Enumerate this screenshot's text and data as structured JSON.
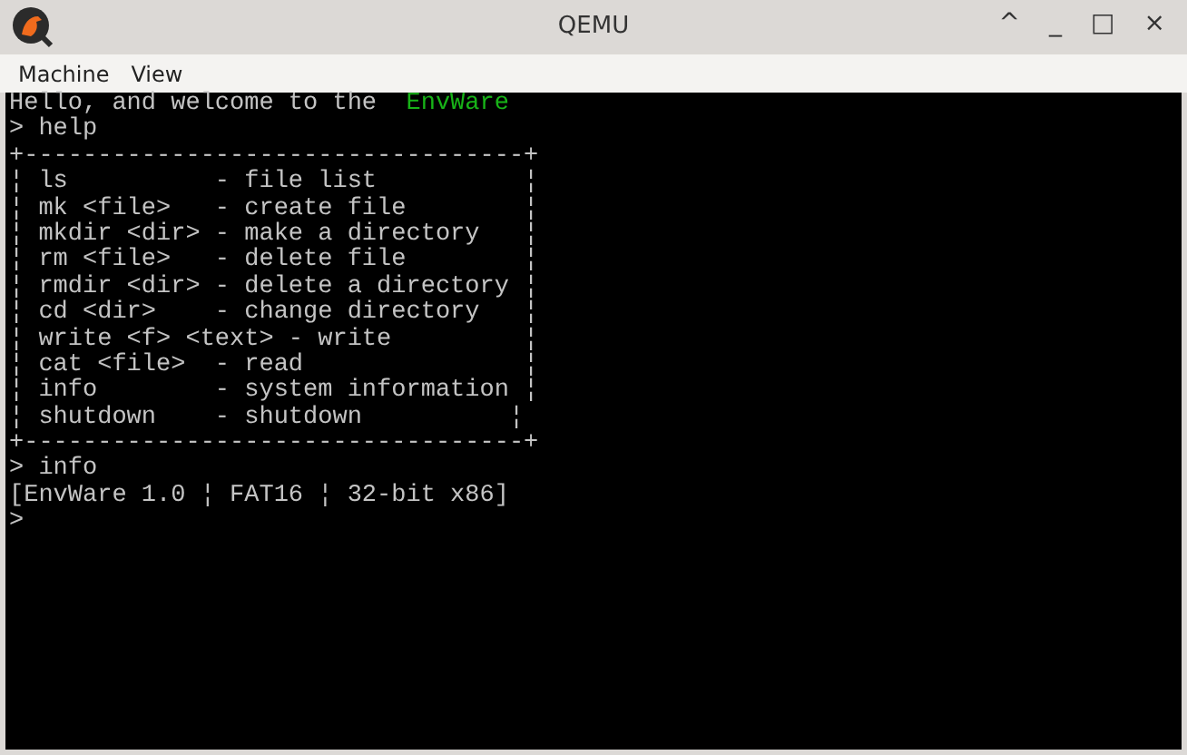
{
  "window": {
    "title": "QEMU",
    "controls": [
      "^",
      "_",
      "□",
      "×"
    ]
  },
  "menu": [
    {
      "label": "Machine"
    },
    {
      "label": "View"
    }
  ],
  "terminal": {
    "lines": [
      {
        "segments": [
          {
            "text": "Hello, and welcome to the  ",
            "kind": "normal"
          },
          {
            "text": "EnvWare",
            "kind": "highlight"
          }
        ]
      },
      {
        "segments": [
          {
            "text": "> help",
            "kind": "normal"
          }
        ]
      },
      {
        "segments": [
          {
            "text": "+----------------------------------+",
            "kind": "normal"
          }
        ]
      },
      {
        "segments": [
          {
            "text": "¦ ls          - file list          ¦",
            "kind": "normal"
          }
        ]
      },
      {
        "segments": [
          {
            "text": "¦ mk <file>   - create file        ¦",
            "kind": "normal"
          }
        ]
      },
      {
        "segments": [
          {
            "text": "¦ mkdir <dir> - make a directory   ¦",
            "kind": "normal"
          }
        ]
      },
      {
        "segments": [
          {
            "text": "¦ rm <file>   - delete file        ¦",
            "kind": "normal"
          }
        ]
      },
      {
        "segments": [
          {
            "text": "¦ rmdir <dir> - delete a directory ¦",
            "kind": "normal"
          }
        ]
      },
      {
        "segments": [
          {
            "text": "¦ cd <dir>    - change directory   ¦",
            "kind": "normal"
          }
        ]
      },
      {
        "segments": [
          {
            "text": "¦ write <f> <text> - write         ¦",
            "kind": "normal"
          }
        ]
      },
      {
        "segments": [
          {
            "text": "¦ cat <file>  - read               ¦",
            "kind": "normal"
          }
        ]
      },
      {
        "segments": [
          {
            "text": "¦ info        - system information ¦",
            "kind": "normal"
          }
        ]
      },
      {
        "segments": [
          {
            "text": "¦ shutdown    - shutdown          ¦",
            "kind": "normal"
          }
        ]
      },
      {
        "segments": [
          {
            "text": "+----------------------------------+",
            "kind": "normal"
          }
        ]
      },
      {
        "segments": [
          {
            "text": "> info",
            "kind": "normal"
          }
        ]
      },
      {
        "segments": [
          {
            "text": "[EnvWare 1.0 ¦ FAT16 ¦ 32-bit x86]",
            "kind": "normal"
          }
        ]
      },
      {
        "segments": [
          {
            "text": ">",
            "kind": "normal"
          }
        ]
      }
    ]
  }
}
